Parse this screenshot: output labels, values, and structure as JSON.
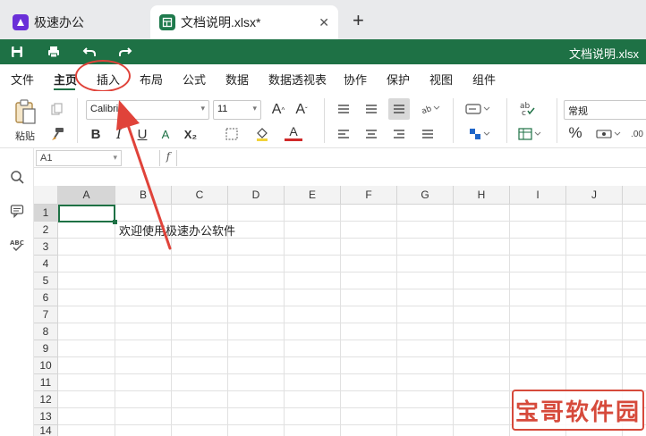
{
  "tabs": {
    "home": {
      "label": "极速办公",
      "icon": "app-logo-icon"
    },
    "doc": {
      "label": "文档说明.xlsx*",
      "icon": "spreadsheet-icon",
      "close": "✕"
    },
    "add": "+"
  },
  "quick_access": {
    "doc_title": "文档说明.xlsx",
    "icons": [
      "save-icon",
      "print-icon",
      "undo-icon",
      "redo-icon"
    ]
  },
  "menu": {
    "items": [
      "文件",
      "主页",
      "插入",
      "布局",
      "公式",
      "数据",
      "数据透视表",
      "协作",
      "保护",
      "视图",
      "组件"
    ],
    "active": "主页",
    "highlighted": "插入"
  },
  "ribbon": {
    "paste_label": "粘贴",
    "font_name": "Calibri",
    "font_size": "11",
    "number_format": "常规",
    "bold": "B",
    "italic": "I",
    "underline": "U",
    "strike": "A",
    "subscript": "X₂",
    "font_color": "A",
    "grow_font": "A^",
    "shrink_font": "A˅",
    "percent": "%"
  },
  "formula_bar": {
    "cell_ref": "A1",
    "fx": "f",
    "value": ""
  },
  "sheet": {
    "columns": [
      "A",
      "B",
      "C",
      "D",
      "E",
      "F",
      "G",
      "H",
      "I",
      "J"
    ],
    "rows": [
      "1",
      "2",
      "3",
      "4",
      "5",
      "6",
      "7",
      "8",
      "9",
      "10",
      "11",
      "12",
      "13",
      "14"
    ],
    "selected_cell": "A1",
    "cell_text": "欢迎使用极速办公软件",
    "cell_text_ref": "B2"
  },
  "watermark": "宝哥软件园",
  "colors": {
    "accent_green": "#1e7145",
    "annotation_red": "#e0433a",
    "logo_purple": "#6a2fd8"
  }
}
